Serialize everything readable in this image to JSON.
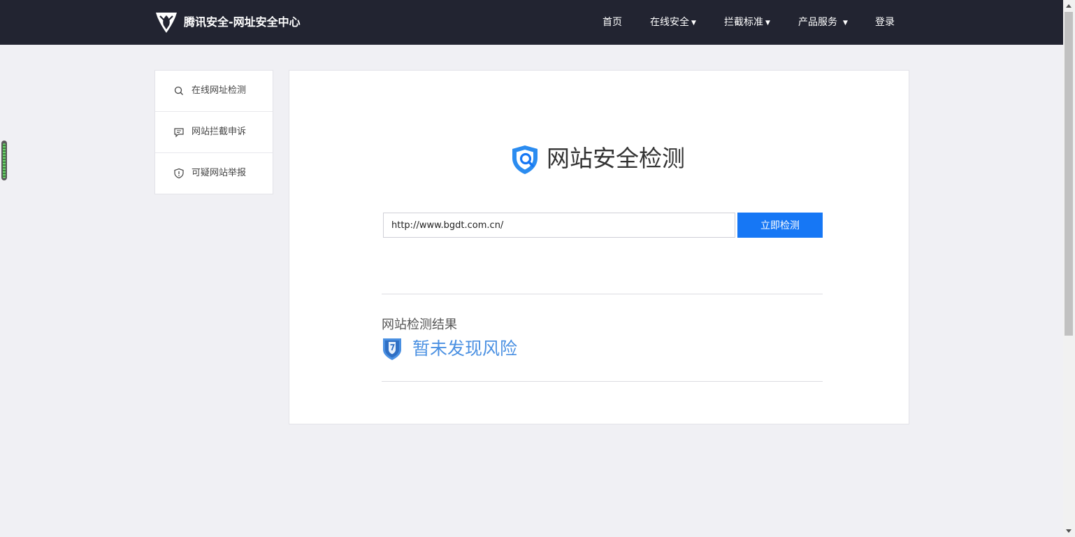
{
  "header": {
    "brand": "腾讯安全-网址安全中心",
    "nav": [
      {
        "label": "首页",
        "dropdown": false
      },
      {
        "label": "在线安全",
        "dropdown": true
      },
      {
        "label": "拦截标准",
        "dropdown": true
      },
      {
        "label": "产品服务",
        "dropdown": true
      },
      {
        "label": "登录",
        "dropdown": false
      }
    ],
    "caret": "▼"
  },
  "sidebar": {
    "items": [
      {
        "label": "在线网址检测",
        "icon": "search-icon"
      },
      {
        "label": "网站拦截申诉",
        "icon": "chat-icon"
      },
      {
        "label": "可疑网站举报",
        "icon": "shield-alert-icon"
      }
    ]
  },
  "main": {
    "title": "网站安全检测",
    "url_input": {
      "value": "http://www.bgdt.com.cn/"
    },
    "check_button": "立即检测",
    "result": {
      "label": "网站检测结果",
      "value": "暂未发现风险",
      "icon": "shield-question-icon"
    }
  },
  "colors": {
    "topbar": "#222431",
    "accent": "#1677f5",
    "result_text": "#4a90e2",
    "background": "#f0f0f4"
  }
}
